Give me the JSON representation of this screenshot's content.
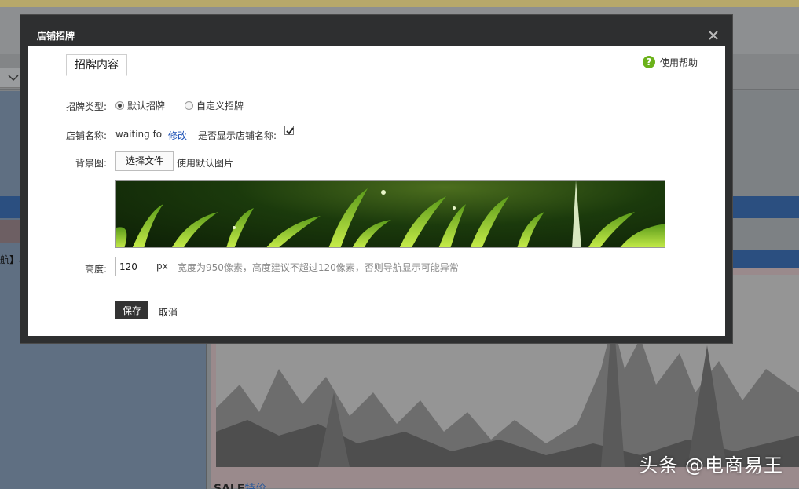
{
  "background": {
    "sidebar_fragment": "航】模",
    "sale_label": "SALE",
    "sale_sub": "特价",
    "watermark": "头条 @电商易王"
  },
  "dialog": {
    "title": "店铺招牌",
    "close_icon": "close-icon",
    "tab_label": "招牌内容",
    "help_label": "使用帮助",
    "help_icon": "question-icon",
    "sign_type": {
      "label": "招牌类型:",
      "options": [
        {
          "label": "默认招牌",
          "checked": true
        },
        {
          "label": "自定义招牌",
          "checked": false
        }
      ]
    },
    "shop_name": {
      "label": "店铺名称:",
      "value": "waiting fo",
      "edit_label": "修改",
      "show_label": "是否显示店铺名称:",
      "show_checked": true
    },
    "background_image": {
      "label": "背景图:",
      "choose_file_label": "选择文件",
      "default_label": "使用默认图片"
    },
    "height": {
      "label": "高度:",
      "value": "120",
      "unit": "px",
      "hint": "宽度为950像素，高度建议不超过120像素，否则导航显示可能异常"
    },
    "save_label": "保存",
    "cancel_label": "取消"
  },
  "colors": {
    "dialog_frame": "#2e2f30",
    "help_icon": "#6bb21a",
    "link": "#1a4fb5",
    "save_button": "#333333"
  }
}
